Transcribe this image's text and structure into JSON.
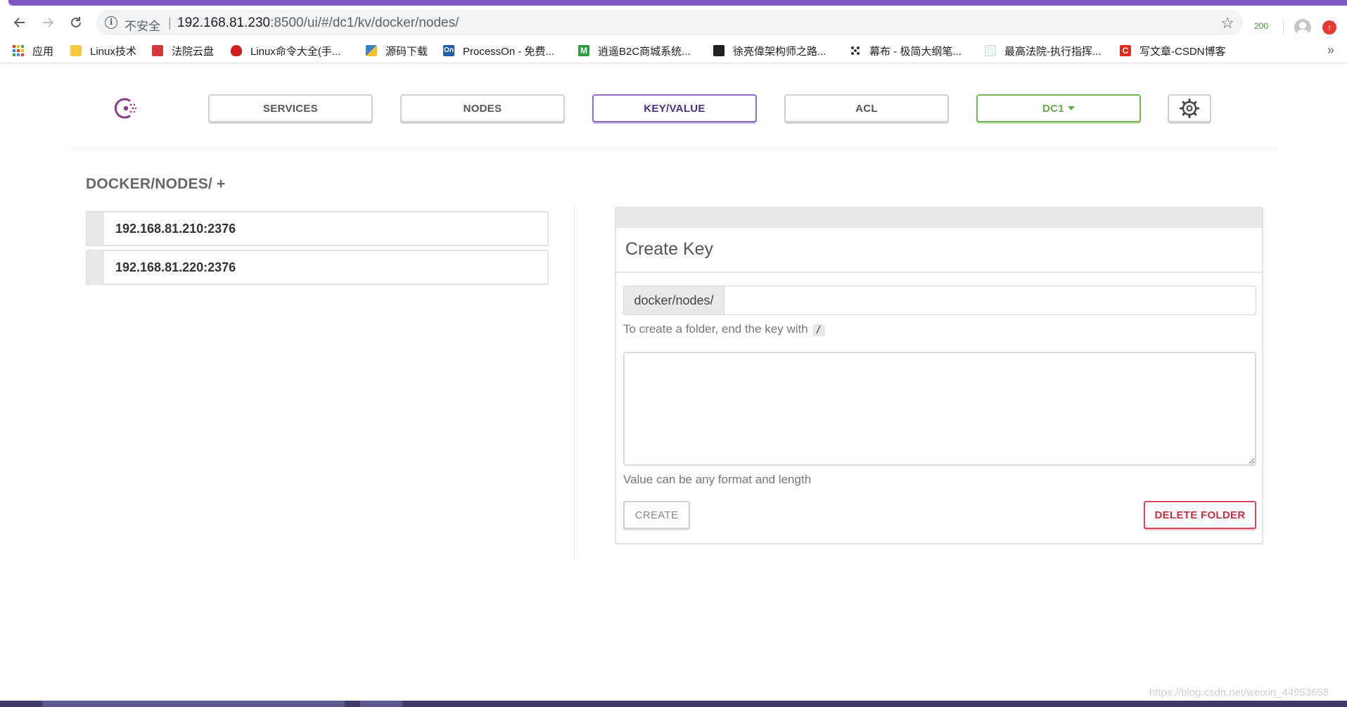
{
  "browser": {
    "security_label": "不安全",
    "url_host": "192.168.81.230",
    "url_rest": ":8500/ui/#/dc1/kv/docker/nodes/",
    "extension_badge": "200",
    "accent_color": "#7e57c2"
  },
  "bookmarks": [
    {
      "label": "应用",
      "icon": "apps-grid-icon"
    },
    {
      "label": "Linux技术",
      "icon": "folder-icon"
    },
    {
      "label": "法院云盘",
      "icon": "cloud-drive-icon"
    },
    {
      "label": "Linux命令大全(手...",
      "icon": "redhat-icon"
    },
    {
      "label": "源码下载",
      "icon": "download-icon"
    },
    {
      "label": "ProcessOn - 免费...",
      "icon": "processon-icon"
    },
    {
      "label": "逍遥B2C商城系统...",
      "icon": "m-icon"
    },
    {
      "label": "徐亮偉架构师之路...",
      "icon": "dark-square-icon"
    },
    {
      "label": "幕布 - 极简大纲笔...",
      "icon": "mubu-icon"
    },
    {
      "label": "最高法院-执行指挥...",
      "icon": "page-icon"
    },
    {
      "label": "写文章-CSDN博客",
      "icon": "csdn-icon"
    }
  ],
  "nav": {
    "services": "SERVICES",
    "nodes": "NODES",
    "kv": "KEY/VALUE",
    "acl": "ACL",
    "dc": "DC1",
    "colors": {
      "active": "#8e6bc5",
      "dc": "#7cb45a"
    }
  },
  "breadcrumb": {
    "path": "DOCKER/NODES/",
    "add": "+"
  },
  "keys": [
    "192.168.81.210:2376",
    "192.168.81.220:2376"
  ],
  "create_panel": {
    "title": "Create Key",
    "prefix": "docker/nodes/",
    "key_value": "",
    "key_placeholder": "",
    "folder_hint": "To create a folder, end the key with",
    "folder_char": "/",
    "value_text": "",
    "value_hint": "Value can be any format and length",
    "create_label": "CREATE",
    "delete_label": "DELETE FOLDER",
    "delete_color": "#d84a57"
  },
  "watermark": "https://blog.csdn.net/weixin_44953658"
}
